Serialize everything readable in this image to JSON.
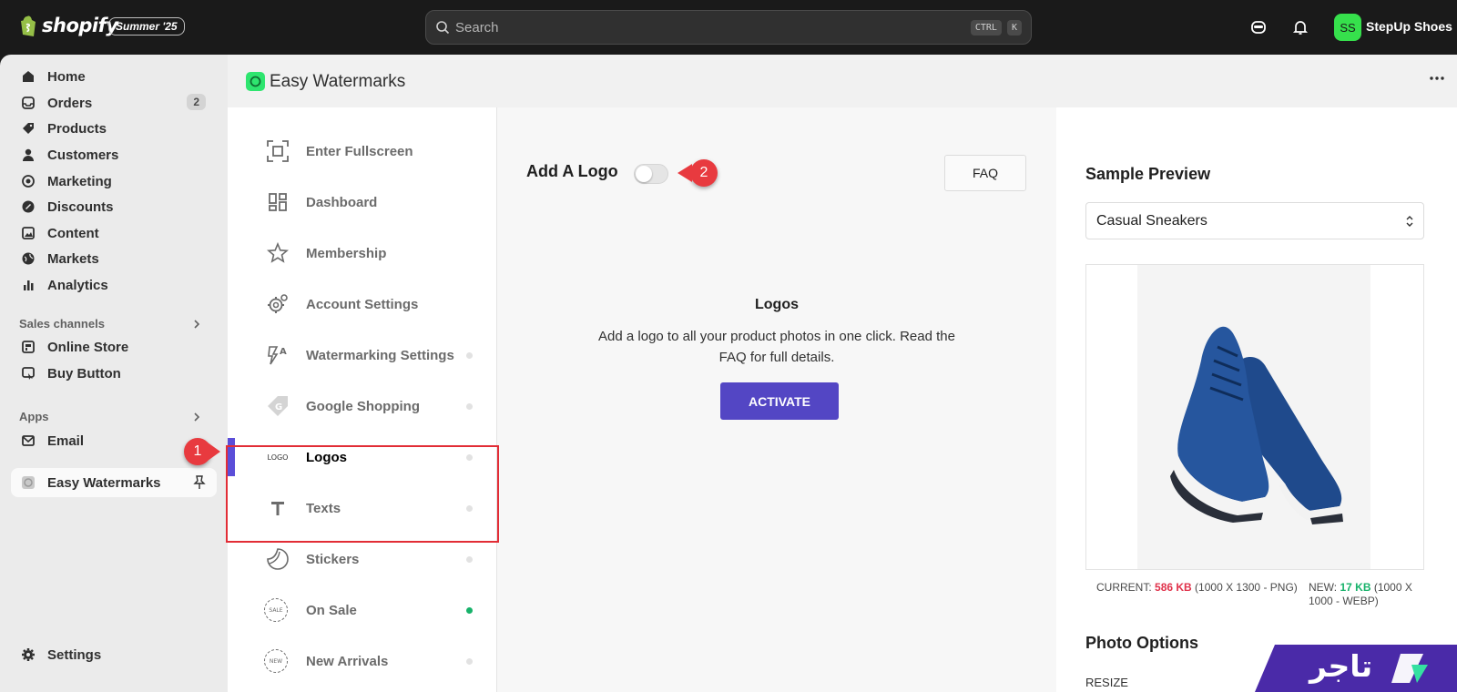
{
  "topbar": {
    "logo_text": "shopify",
    "edition_badge": "Summer '25",
    "search_placeholder": "Search",
    "shortcut_keys": [
      "CTRL",
      "K"
    ],
    "avatar_initials": "SS",
    "store_name": "StepUp Shoes",
    "icons": [
      "shopify-bag-icon",
      "search-icon",
      "sidekick-icon",
      "bell-icon"
    ]
  },
  "sidebar": {
    "items": [
      {
        "label": "Home",
        "icon": "home-icon"
      },
      {
        "label": "Orders",
        "icon": "inbox-icon",
        "badge": "2"
      },
      {
        "label": "Products",
        "icon": "tag-icon"
      },
      {
        "label": "Customers",
        "icon": "person-icon"
      },
      {
        "label": "Marketing",
        "icon": "target-icon"
      },
      {
        "label": "Discounts",
        "icon": "discount-icon"
      },
      {
        "label": "Content",
        "icon": "image-icon"
      },
      {
        "label": "Markets",
        "icon": "globe-icon"
      },
      {
        "label": "Analytics",
        "icon": "bar-chart-icon"
      }
    ],
    "sales_channels_heading": "Sales channels",
    "sales_channels": [
      {
        "label": "Online Store",
        "icon": "store-icon"
      },
      {
        "label": "Buy Button",
        "icon": "buy-button-icon"
      }
    ],
    "apps_heading": "Apps",
    "apps": [
      {
        "label": "Email",
        "icon": "email-icon"
      }
    ],
    "pinned_app": {
      "label": "Easy Watermarks",
      "icon": "app-icon"
    },
    "settings_label": "Settings"
  },
  "app": {
    "title": "Easy Watermarks",
    "menu": [
      {
        "label": "Enter Fullscreen",
        "icon": "fullscreen-icon",
        "dot": false
      },
      {
        "label": "Dashboard",
        "icon": "dashboard-icon",
        "dot": false
      },
      {
        "label": "Membership",
        "icon": "star-icon",
        "dot": false
      },
      {
        "label": "Account Settings",
        "icon": "gear-icon",
        "dot": false
      },
      {
        "label": "Watermarking Settings",
        "icon": "watermark-icon",
        "dot": true
      },
      {
        "label": "Google Shopping",
        "icon": "google-tag-icon",
        "dot": true
      },
      {
        "label": "Logos",
        "icon": "logo-text-icon",
        "icon_text": "LOGO",
        "dot": true,
        "active": true
      },
      {
        "label": "Texts",
        "icon": "text-t-icon",
        "dot": true
      },
      {
        "label": "Stickers",
        "icon": "sticker-icon",
        "dot": true
      },
      {
        "label": "On Sale",
        "icon": "sale-badge-icon",
        "icon_text": "SALE",
        "dot": true,
        "dot_color": "#17b26a"
      },
      {
        "label": "New Arrivals",
        "icon": "new-badge-icon",
        "icon_text": "NEW",
        "dot": true
      }
    ],
    "content": {
      "heading": "Add A Logo",
      "toggle_on": false,
      "faq_label": "FAQ",
      "empty_title": "Logos",
      "empty_description": "Add a logo to all your product photos in one click. Read the FAQ for full details.",
      "activate_label": "ACTIVATE"
    },
    "preview": {
      "title": "Sample Preview",
      "selected_product": "Casual Sneakers",
      "current_label": "CURRENT:",
      "current_size": "586 KB",
      "current_details": "(1000 X 1300 - PNG)",
      "new_label": "NEW:",
      "new_size": "17 KB",
      "new_details": "(1000 X 1000 - WEBP)",
      "photo_options_title": "Photo Options",
      "resize_label": "RESIZE"
    }
  },
  "annotations": {
    "callout_1": "1",
    "callout_2": "2"
  },
  "brand_watermark": "تاجر",
  "colors": {
    "accent": "#5b4ed8",
    "activate_button": "#5346c4",
    "highlight": "#e22d36",
    "current_size": "#e0324b",
    "new_size": "#17b26a",
    "avatar": "#36e04c"
  }
}
